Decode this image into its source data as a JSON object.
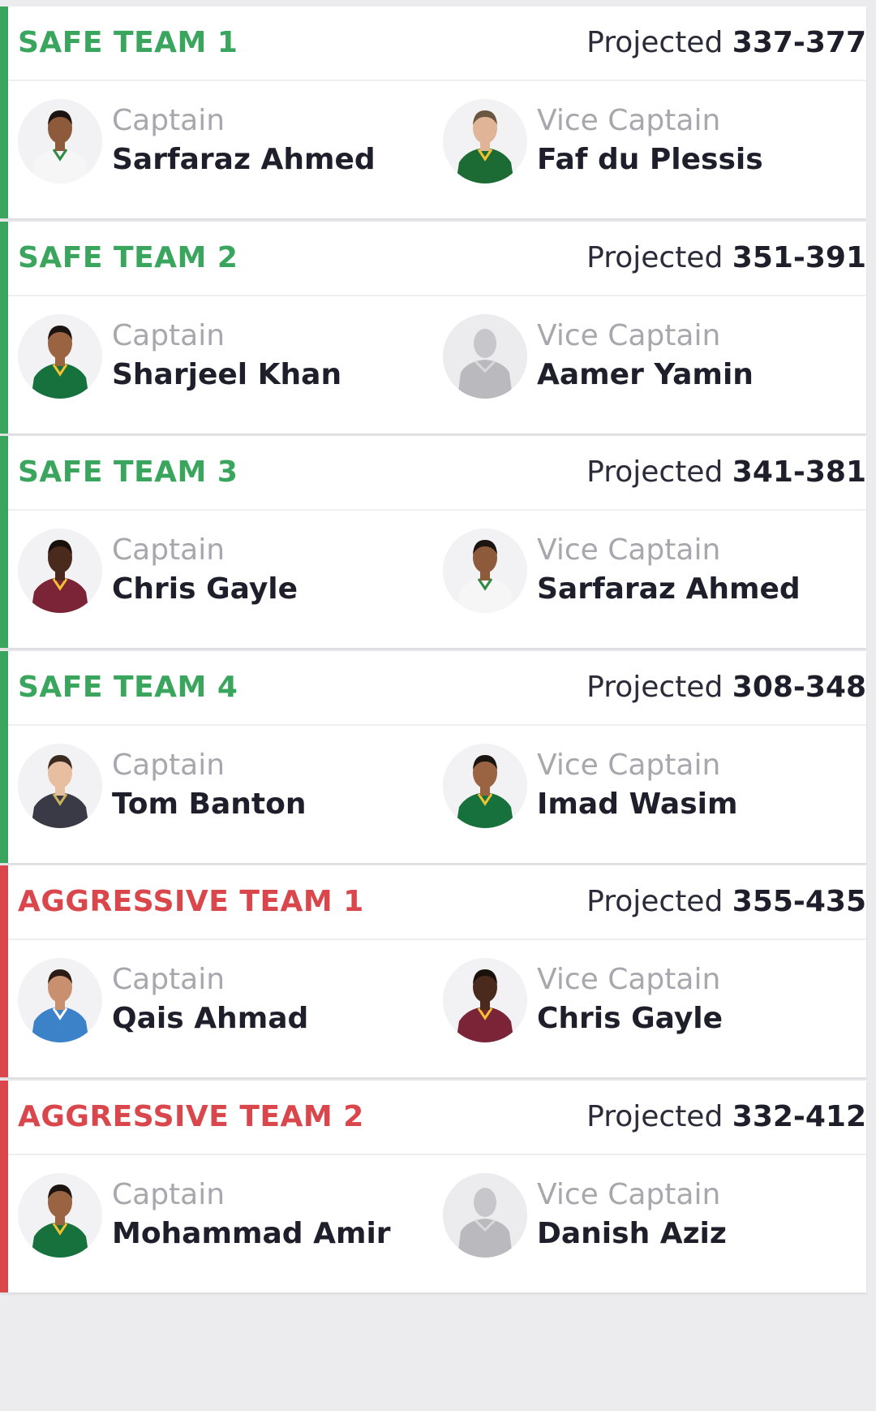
{
  "labels": {
    "projected_prefix": "Projected",
    "captain_role": "Captain",
    "vice_captain_role": "Vice Captain"
  },
  "colors": {
    "safe": "#3aa55d",
    "aggressive": "#d9464b",
    "page_background": "#ececef",
    "card_background": "#ffffff"
  },
  "teams": [
    {
      "name": "SAFE TEAM 1",
      "type": "safe",
      "projected": "337-377",
      "captain": {
        "name": "Sarfaraz Ahmed",
        "avatar": "player-photo-pakistan-white"
      },
      "vice_captain": {
        "name": "Faf du Plessis",
        "avatar": "player-photo-south-africa-green"
      }
    },
    {
      "name": "SAFE TEAM 2",
      "type": "safe",
      "projected": "351-391",
      "captain": {
        "name": "Sharjeel Khan",
        "avatar": "player-photo-pakistan-green"
      },
      "vice_captain": {
        "name": "Aamer Yamin",
        "avatar": "placeholder-silhouette"
      }
    },
    {
      "name": "SAFE TEAM 3",
      "type": "safe",
      "projected": "341-381",
      "captain": {
        "name": "Chris Gayle",
        "avatar": "player-photo-west-indies-maroon"
      },
      "vice_captain": {
        "name": "Sarfaraz Ahmed",
        "avatar": "player-photo-pakistan-white"
      }
    },
    {
      "name": "SAFE TEAM 4",
      "type": "safe",
      "projected": "308-348",
      "captain": {
        "name": "Tom Banton",
        "avatar": "player-photo-dark-shirt"
      },
      "vice_captain": {
        "name": "Imad Wasim",
        "avatar": "player-photo-pakistan-green"
      }
    },
    {
      "name": "AGGRESSIVE TEAM 1",
      "type": "aggressive",
      "projected": "355-435",
      "captain": {
        "name": "Qais Ahmad",
        "avatar": "player-photo-afghanistan-blue"
      },
      "vice_captain": {
        "name": "Chris Gayle",
        "avatar": "player-photo-west-indies-maroon"
      }
    },
    {
      "name": "AGGRESSIVE TEAM 2",
      "type": "aggressive",
      "projected": "332-412",
      "captain": {
        "name": "Mohammad Amir",
        "avatar": "player-photo-pakistan-green"
      },
      "vice_captain": {
        "name": "Danish Aziz",
        "avatar": "placeholder-silhouette"
      }
    }
  ]
}
